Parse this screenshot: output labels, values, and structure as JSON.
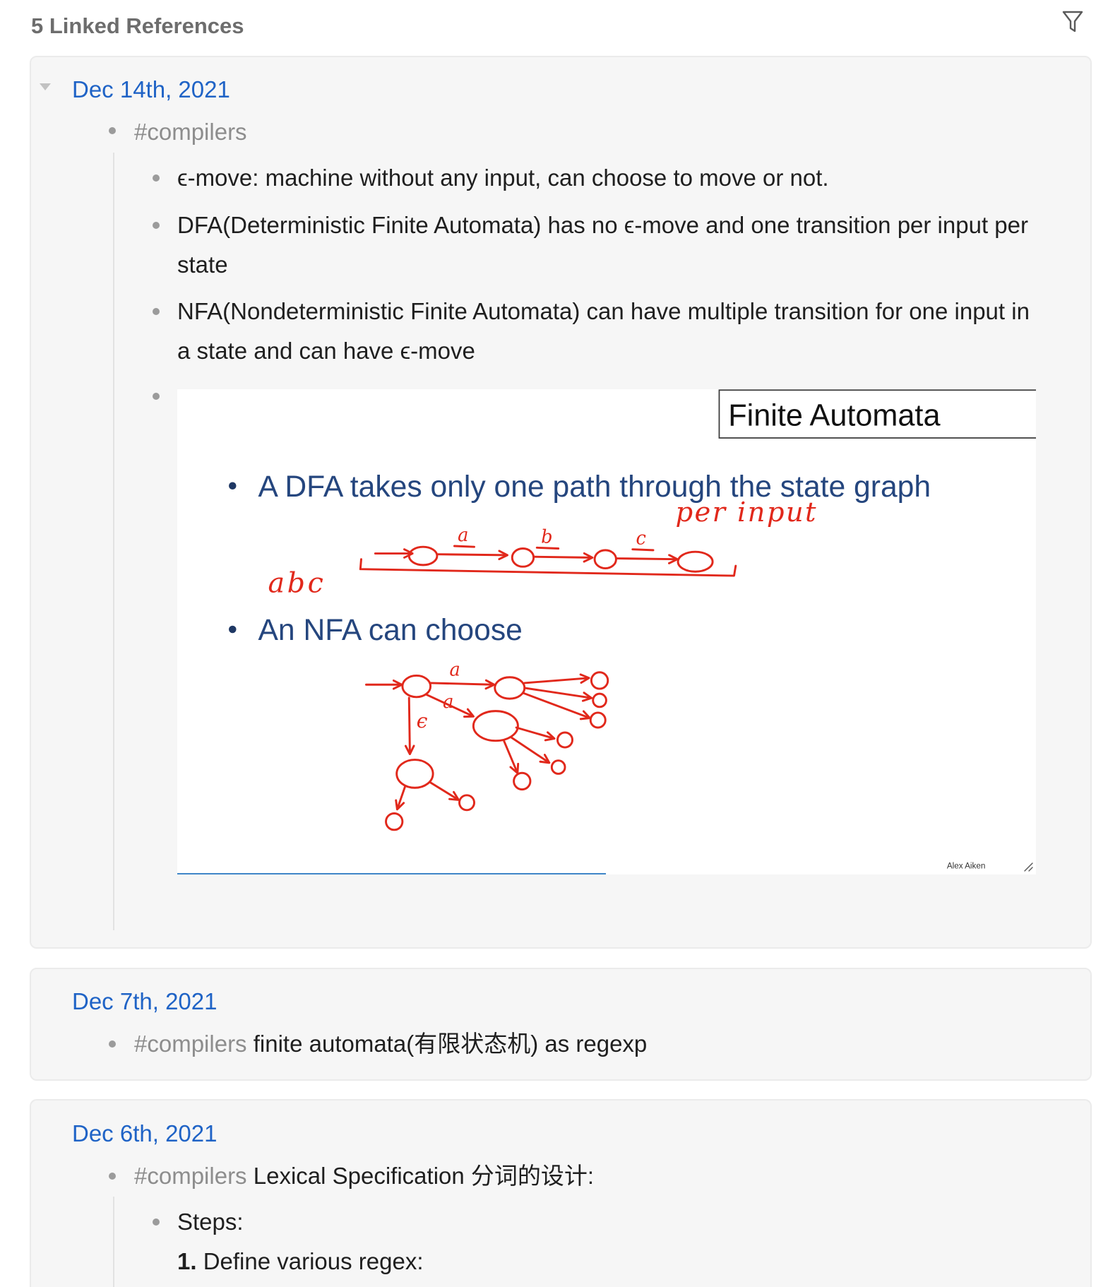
{
  "header": {
    "title": "5 Linked References",
    "filter_icon": "filter-icon"
  },
  "colors": {
    "page_link": "#1f63c6",
    "tag": "#8d8d8d",
    "body_text": "#1f1f1f",
    "header_text": "#6d6d6d",
    "card_background": "#f6f6f6",
    "bullet": "#9b9b9b",
    "slide_text_blue": "#25467e",
    "annotation_red": "#e1281b"
  },
  "references": [
    {
      "date": "Dec 14th, 2021",
      "toggle_icon": "caret-down-icon",
      "tag": "#compilers",
      "children": [
        {
          "text": "ϵ-move: machine without any input, can choose to move or not."
        },
        {
          "text": "DFA(Deterministic Finite Automata) has no ϵ-move and one transition per input per state"
        },
        {
          "text": "NFA(Nondeterministic Finite Automata) can have multiple transition for one input in a state and can have ϵ-move"
        },
        {
          "image": {
            "title": "Finite Automata",
            "bullets": [
              "A DFA takes only one path through the state graph",
              "An NFA can choose"
            ],
            "handwriting": {
              "dfa_note": "per input",
              "dfa_input": "abc",
              "dfa_transitions": [
                "a",
                "b",
                "c"
              ],
              "nfa_transitions": [
                "a",
                "a"
              ],
              "nfa_epsilon": "ϵ"
            },
            "credit": "Alex Aiken",
            "resize_icon": "resize-handle-icon"
          }
        }
      ]
    },
    {
      "date": "Dec 7th, 2021",
      "tag": "#compilers",
      "text": "finite automata(有限状态机) as regexp"
    },
    {
      "date": "Dec 6th, 2021",
      "tag": "#compilers",
      "text": "Lexical Specification 分词的设计:",
      "children": [
        {
          "text": "Steps:",
          "list": [
            {
              "marker": "1.",
              "text": "Define various regex:"
            }
          ]
        }
      ]
    }
  ]
}
